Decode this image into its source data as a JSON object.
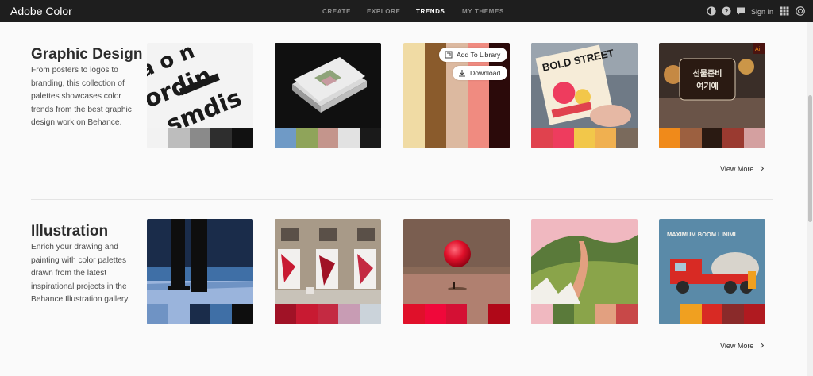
{
  "app": {
    "title": "Adobe Color"
  },
  "nav": {
    "items": [
      {
        "label": "CREATE",
        "active": false
      },
      {
        "label": "EXPLORE",
        "active": false
      },
      {
        "label": "TRENDS",
        "active": true
      },
      {
        "label": "MY THEMES",
        "active": false
      }
    ],
    "sign_in": "Sign In",
    "icons": [
      "theme-toggle-icon",
      "help-icon",
      "feedback-icon",
      "apps-grid-icon",
      "creative-cloud-icon"
    ]
  },
  "sections": [
    {
      "title": "Graphic Design",
      "description": "From posters to logos to branding, this collection of palettes showcases color trends from the best graphic design work on Behance.",
      "view_more": "View More",
      "cards": [
        {
          "art": "typography-poster",
          "swatches": [
            "#f2f2f2",
            "#bdbdbd",
            "#8a8a8a",
            "#2e2e2e",
            "#111111"
          ]
        },
        {
          "art": "book-mockup",
          "swatches": [
            "#6f9ac6",
            "#8fa45a",
            "#c4958c",
            "#e2e2e2",
            "#1a1a1a"
          ]
        },
        {
          "art": "color-stripes",
          "swatches": [
            "#f0dba4",
            "#8a5b2c",
            "#dcb9a0",
            "#f08b80",
            "#2b0a0a"
          ]
        },
        {
          "art": "bold-street-poster",
          "printed_text": "BOLD STREET",
          "swatches": [
            "#e0424e",
            "#ee3c5e",
            "#f2c74a",
            "#f0b050",
            "#7a6a5c"
          ]
        },
        {
          "art": "korean-signage",
          "printed_text": "선물준비 여기에",
          "swatches": [
            "#f08a1a",
            "#9c6040",
            "#2a1a12",
            "#9a3a30",
            "#d4a0a0"
          ]
        }
      ],
      "hover": {
        "add_to_library": "Add To Library",
        "download": "Download"
      }
    },
    {
      "title": "Illustration",
      "description": "Enrich your drawing and painting with color palettes drawn from the latest inspirational projects in the Behance Illustration gallery.",
      "view_more": "View More",
      "cards": [
        {
          "art": "night-figure",
          "swatches": [
            "#6f93c4",
            "#9ab4dc",
            "#1a2c4a",
            "#3f6fa6",
            "#0e0e0e"
          ]
        },
        {
          "art": "street-murals",
          "swatches": [
            "#a01226",
            "#c81a32",
            "#c42a42",
            "#c89cb4",
            "#cbd3da"
          ]
        },
        {
          "art": "red-sphere",
          "swatches": [
            "#e0102a",
            "#f0083a",
            "#d41034",
            "#b08070",
            "#b00818"
          ]
        },
        {
          "art": "green-hills",
          "swatches": [
            "#f0b8c0",
            "#5a7a3a",
            "#8aa44a",
            "#e2a080",
            "#c84848"
          ]
        },
        {
          "art": "truck-illustration",
          "printed_text": "MAXIMUM BOOM LINIMI",
          "swatches": [
            "#5a8aa8",
            "#f0a020",
            "#d82a24",
            "#8a2a2a",
            "#b01a20"
          ]
        }
      ]
    }
  ]
}
